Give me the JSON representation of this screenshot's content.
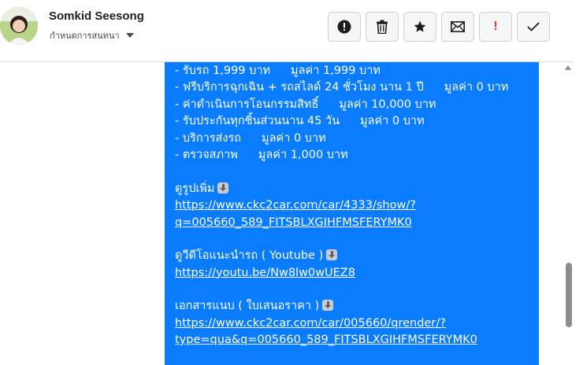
{
  "header": {
    "user_name": "Somkid Seesong",
    "subtitle": "กำหนดการสนทนา",
    "buttons": [
      {
        "name": "alert-circle",
        "icon": "exclamation-circle-icon"
      },
      {
        "name": "delete",
        "icon": "trash-icon"
      },
      {
        "name": "star",
        "icon": "star-icon"
      },
      {
        "name": "mail",
        "icon": "envelope-icon"
      },
      {
        "name": "important",
        "icon": "red-exclamation-icon",
        "label": "!"
      },
      {
        "name": "done",
        "icon": "check-icon"
      }
    ]
  },
  "message": {
    "items": [
      {
        "text": "- รับรถ 1,999 บาท",
        "value": "มูลค่า 1,999 บาท"
      },
      {
        "text": "- ฟรีบริการฉุกเฉิน + รถสไลด์ 24 ชั่วโมง นาน 1 ปี",
        "value": "มูลค่า 0 บาท"
      },
      {
        "text": "- ค่าดำเนินการโอนกรรมสิทธิ์",
        "value": "มูลค่า 10,000 บาท"
      },
      {
        "text": "- รับประกันทุกชิ้นส่วนนาน 45 วัน",
        "value": "มูลค่า 0 บาท"
      },
      {
        "text": "- บริการส่งรถ",
        "value": "มูลค่า 0 บาท"
      },
      {
        "text": "- ตรวจสภาพ",
        "value": "มูลค่า 1,000 บาท"
      }
    ],
    "photos_label": "ดูรูปเพิ่ม",
    "photos_link_1": "https://www.ckc2car.com/car/4333/show/?",
    "photos_link_2": "q=005660_589_FITSBLXGIHFMSFERYMK0",
    "video_label": "ดูวีดีโอแนะนำรถ ( Youtube )",
    "video_link": "https://youtu.be/Nw8lw0wUEZ8",
    "doc_label": "เอกสารแนบ ( ใบเสนอราคา )",
    "doc_link_1": "https://www.ckc2car.com/car/005660/qrender/?",
    "doc_link_2": "type=qua&q=005660_589_FITSBLXGIHFMSFERYMK0"
  },
  "colors": {
    "bubble": "#0a7cff",
    "scroll_thumb": "#8a8d91",
    "important_red": "#e0382b"
  }
}
